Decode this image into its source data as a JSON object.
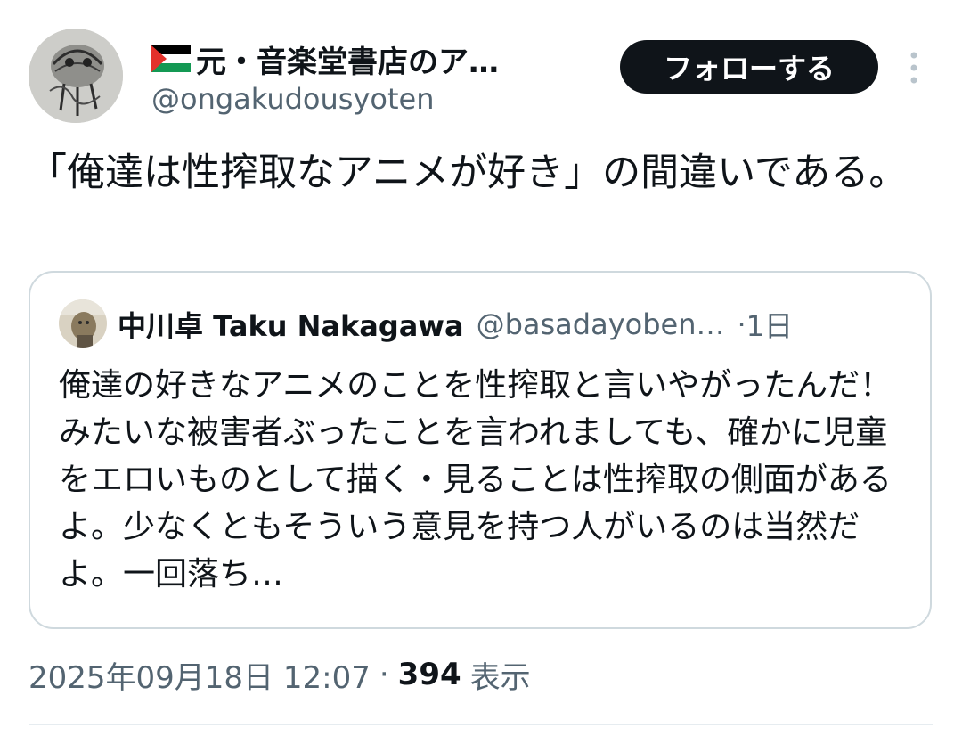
{
  "post": {
    "author_name": "元・音楽堂書店のア…",
    "author_handle": "@ongakudousyoten",
    "author_flag_icon": "palestine-flag-icon",
    "follow_label": "フォローする",
    "text": "「俺達は性搾取なアニメが好き」の間違いである。",
    "timestamp": "2025年09月18日 12:07",
    "separator": "·",
    "views_count": "394",
    "views_label": "表示"
  },
  "quote": {
    "author_name": "中川卓 Taku Nakagawa",
    "author_handle": "@basadayoben…",
    "separator": "·",
    "time": "1日",
    "text": "俺達の好きなアニメのことを性搾取と言いやがったんだ！みたいな被害者ぶったことを言われましても、確かに児童をエロいものとして描く・見ることは性搾取の側面があるよ。少なくともそういう意見を持つ人がいるのは当然だよ。一回落ち…"
  },
  "colors": {
    "text_primary": "#0f1419",
    "text_secondary": "#536471",
    "border": "#cfd9de",
    "button_bg": "#0f1419",
    "button_text": "#ffffff"
  }
}
